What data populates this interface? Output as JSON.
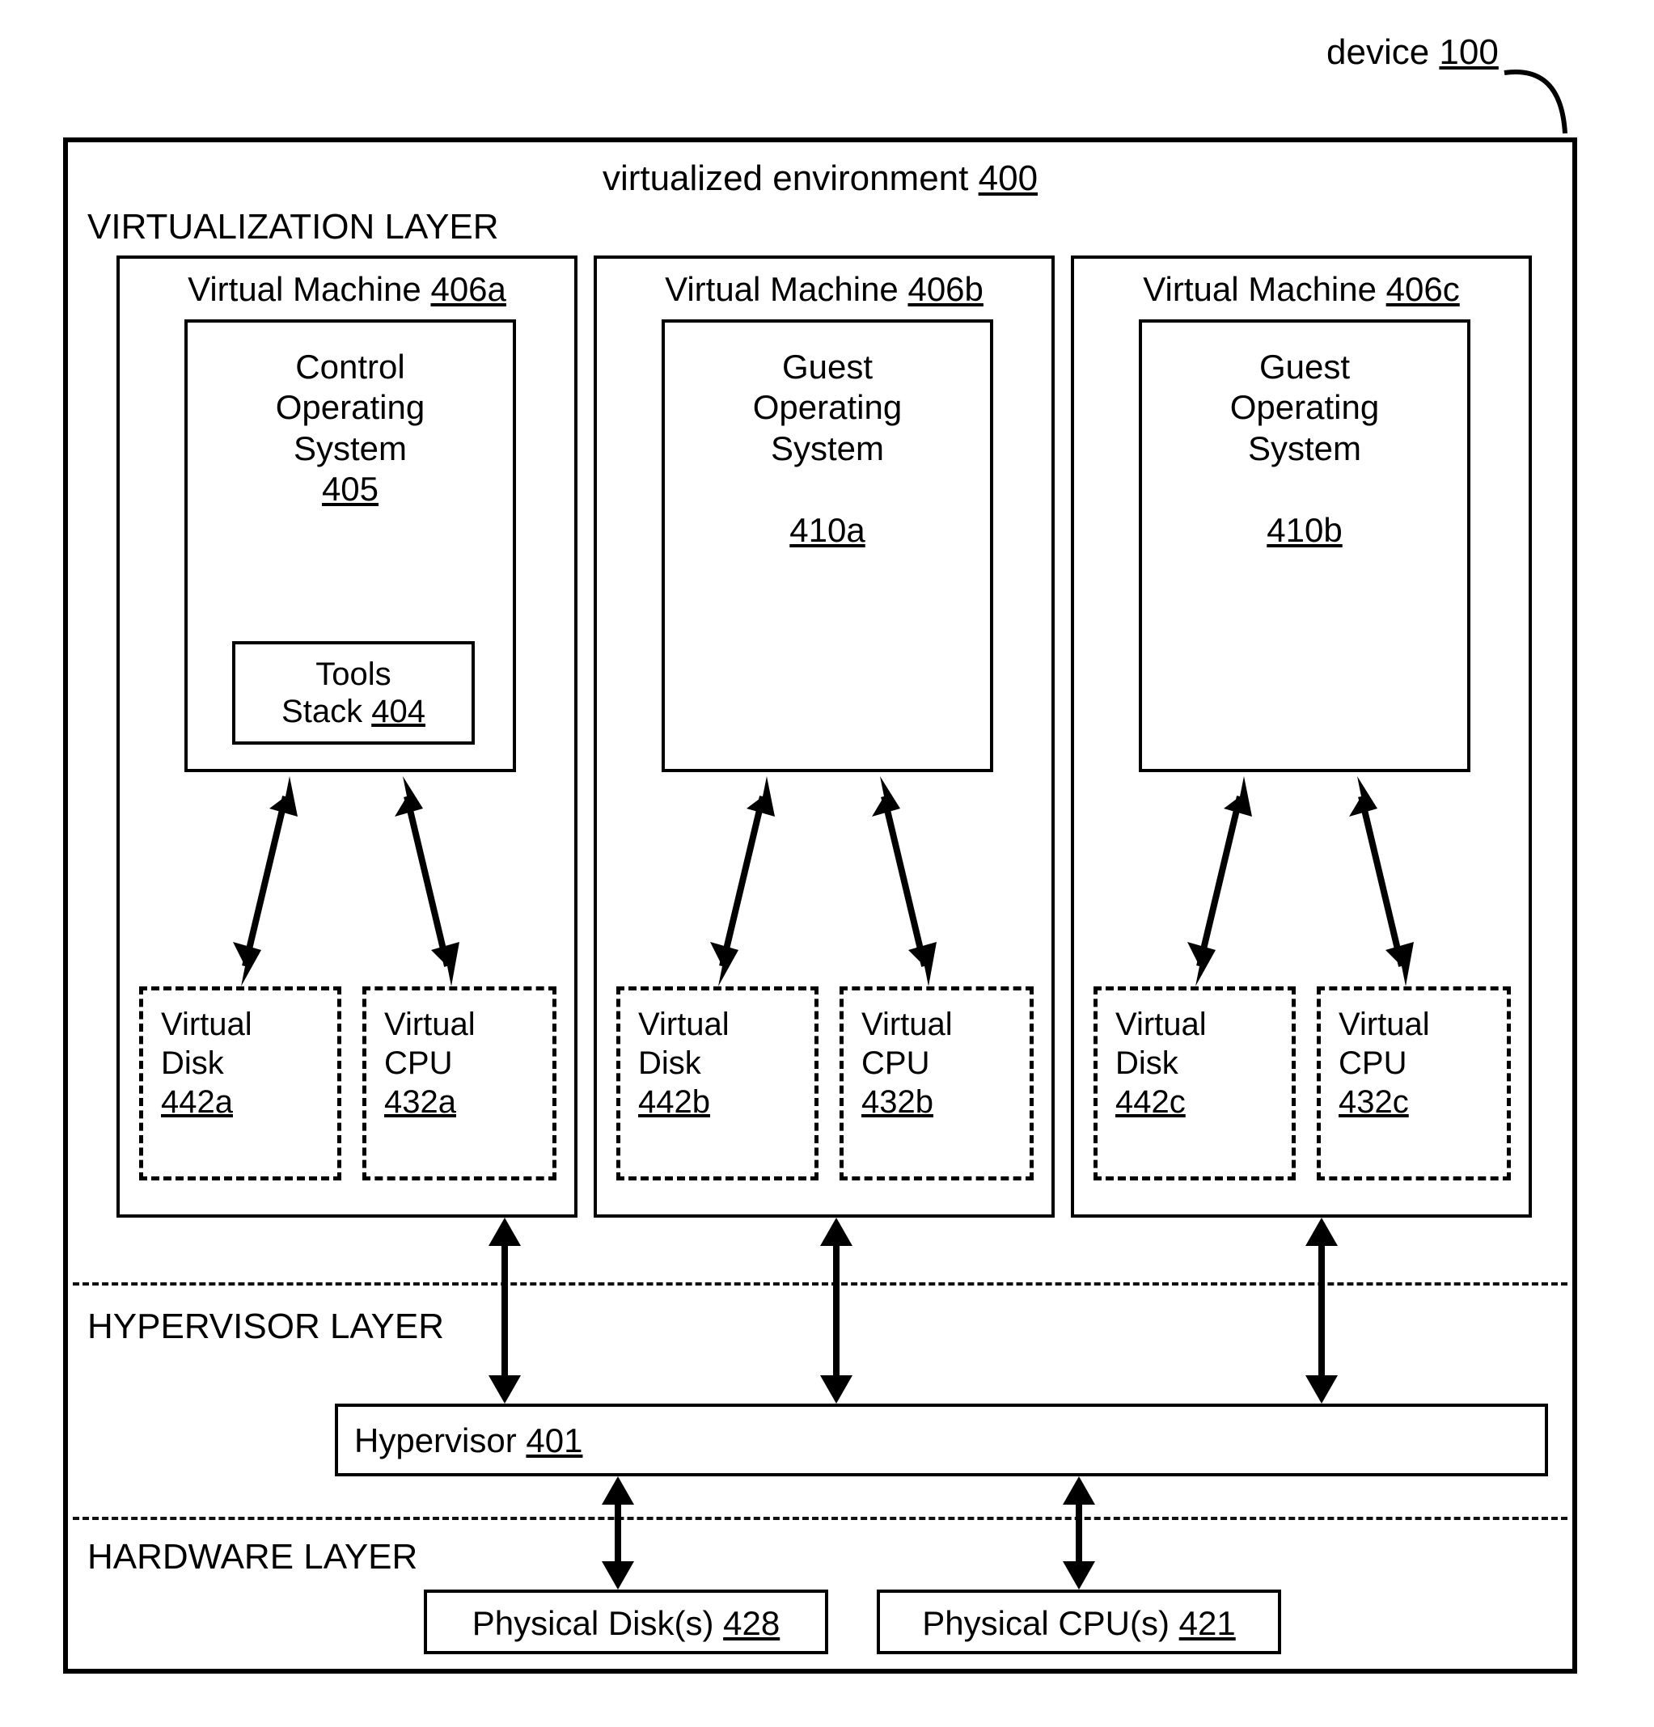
{
  "device_label_text": "device",
  "device_ref": "100",
  "env_title_text": "virtualized environment",
  "env_ref": "400",
  "layers": {
    "virtualization": "VIRTUALIZATION LAYER",
    "hypervisor": "HYPERVISOR LAYER",
    "hardware": "HARDWARE LAYER"
  },
  "vms": [
    {
      "title_text": "Virtual Machine",
      "title_ref": "406a",
      "os_l1": "Control",
      "os_l2": "Operating",
      "os_l3": "System",
      "os_ref": "405",
      "tools_l1": "Tools",
      "tools_l2_text": "Stack",
      "tools_l2_ref": "404",
      "vd_l1": "Virtual",
      "vd_l2": "Disk",
      "vd_ref": "442a",
      "vc_l1": "Virtual",
      "vc_l2": "CPU",
      "vc_ref": "432a"
    },
    {
      "title_text": "Virtual Machine",
      "title_ref": "406b",
      "os_l1": "Guest",
      "os_l2": "Operating",
      "os_l3": "System",
      "os_ref": "410a",
      "vd_l1": "Virtual",
      "vd_l2": "Disk",
      "vd_ref": "442b",
      "vc_l1": "Virtual",
      "vc_l2": "CPU",
      "vc_ref": "432b"
    },
    {
      "title_text": "Virtual Machine",
      "title_ref": "406c",
      "os_l1": "Guest",
      "os_l2": "Operating",
      "os_l3": "System",
      "os_ref": "410b",
      "vd_l1": "Virtual",
      "vd_l2": "Disk",
      "vd_ref": "442c",
      "vc_l1": "Virtual",
      "vc_l2": "CPU",
      "vc_ref": "432c"
    }
  ],
  "hypervisor_text": "Hypervisor",
  "hypervisor_ref": "401",
  "hw_disk_text": "Physical Disk(s)",
  "hw_disk_ref": "428",
  "hw_cpu_text": "Physical CPU(s)",
  "hw_cpu_ref": "421"
}
